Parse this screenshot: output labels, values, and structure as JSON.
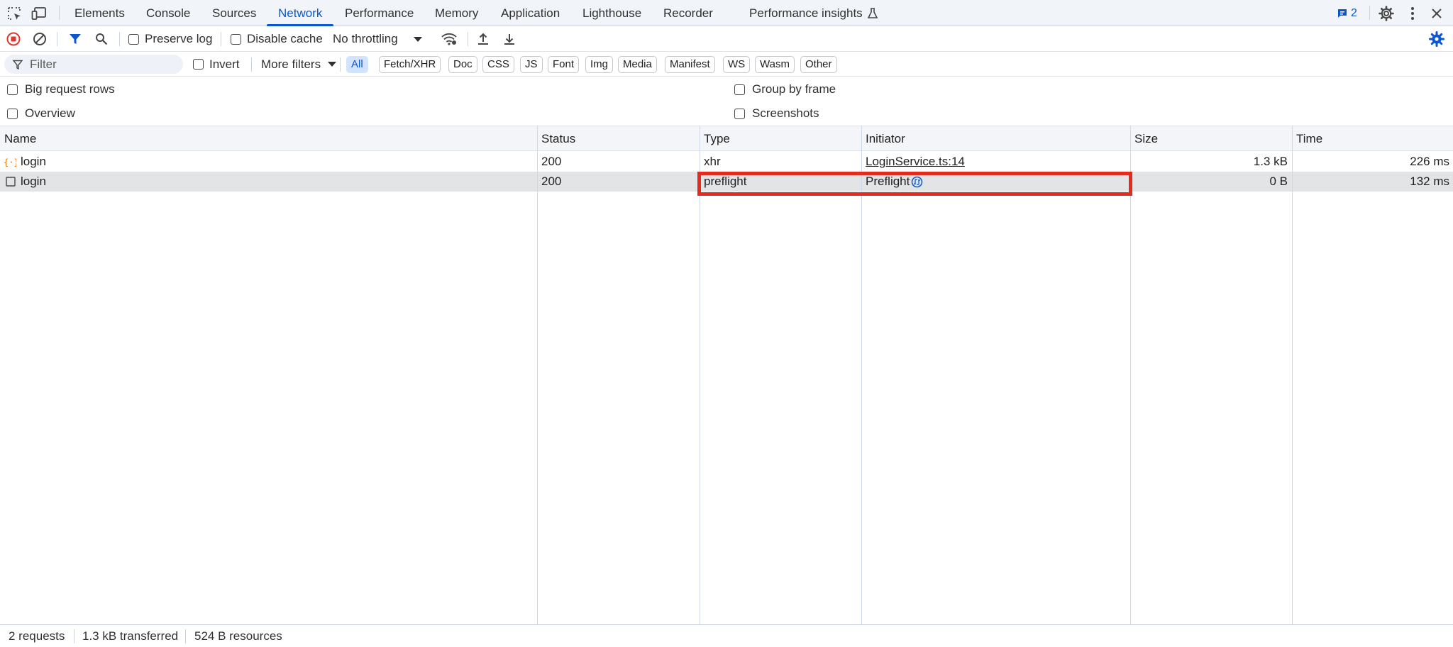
{
  "tabs": [
    {
      "label": "Elements"
    },
    {
      "label": "Console"
    },
    {
      "label": "Sources"
    },
    {
      "label": "Network",
      "active": true
    },
    {
      "label": "Performance"
    },
    {
      "label": "Memory"
    },
    {
      "label": "Application"
    },
    {
      "label": "Lighthouse"
    },
    {
      "label": "Recorder"
    },
    {
      "label": "Performance insights"
    }
  ],
  "issues_count": "2",
  "toolbar": {
    "preserve_log": "Preserve log",
    "disable_cache": "Disable cache",
    "throttling": "No throttling"
  },
  "filter": {
    "placeholder": "Filter",
    "invert": "Invert",
    "more_filters": "More filters",
    "types": [
      "All",
      "Fetch/XHR",
      "Doc",
      "CSS",
      "JS",
      "Font",
      "Img",
      "Media",
      "Manifest",
      "WS",
      "Wasm",
      "Other"
    ],
    "selected_type": "All"
  },
  "settings": {
    "big_request_rows": "Big request rows",
    "overview": "Overview",
    "group_by_frame": "Group by frame",
    "screenshots": "Screenshots"
  },
  "table": {
    "columns": [
      "Name",
      "Status",
      "Type",
      "Initiator",
      "Size",
      "Time"
    ],
    "rows": [
      {
        "name": "login",
        "status": "200",
        "type": "xhr",
        "initiator": "LoginService.ts:14",
        "size": "1.3 kB",
        "time": "226 ms",
        "icon": "xhr-icon"
      },
      {
        "name": "login",
        "status": "200",
        "type": "preflight",
        "initiator": "Preflight",
        "size": "0 B",
        "time": "132 ms",
        "icon": "document-icon"
      }
    ]
  },
  "status": {
    "requests": "2 requests",
    "transferred": "1.3 kB transferred",
    "resources": "524 B resources"
  },
  "colors": {
    "accent": "#0b57d0",
    "highlight": "#e32b1f",
    "record_red": "#dc362e"
  }
}
